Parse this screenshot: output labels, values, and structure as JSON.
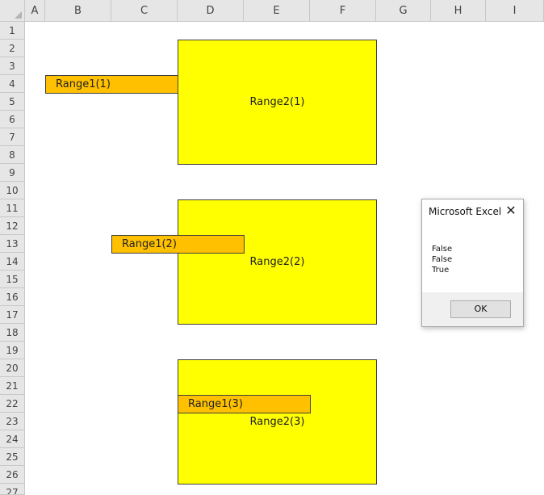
{
  "spreadsheet": {
    "columns": [
      "A",
      "B",
      "C",
      "D",
      "E",
      "F",
      "G",
      "H",
      "I"
    ],
    "rows": [
      "1",
      "2",
      "3",
      "4",
      "5",
      "6",
      "7",
      "8",
      "9",
      "10",
      "11",
      "12",
      "13",
      "14",
      "15",
      "16",
      "17",
      "18",
      "19",
      "20",
      "21",
      "22",
      "23",
      "24",
      "25",
      "26",
      "27"
    ]
  },
  "shapes": {
    "range2_1": "Range2(1)",
    "range1_1": "Range1(1)",
    "range2_2": "Range2(2)",
    "range1_2": "Range1(2)",
    "range2_3": "Range2(3)",
    "range1_3": "Range1(3)"
  },
  "colors": {
    "range2_fill": "#ffff00",
    "range1_fill": "#ffc000",
    "header_bg": "#e6e6e6"
  },
  "dialog": {
    "title": "Microsoft Excel",
    "close_icon": "close-icon",
    "lines": [
      "False",
      "False",
      "True"
    ],
    "ok_label": "OK"
  }
}
